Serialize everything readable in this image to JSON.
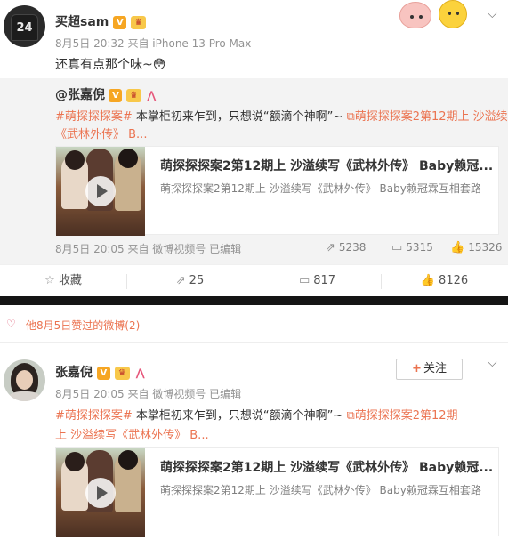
{
  "post1": {
    "username": "买超sam",
    "avatar_text": "24",
    "meta": "8月5日 20:32 来自 iPhone 13 Pro Max",
    "text": "还真有点那个味~",
    "text_emoji": "😳",
    "repost": {
      "author": "@张嘉倪",
      "topic": "#萌探探探案#",
      "body": " 本掌柜初来乍到，只想说“额滴个神啊”~ ",
      "link_label": "萌探探探案2第12期上 沙溢续写",
      "body_line2": "《武林外传》 B...",
      "video_title": "萌探探探案2第12期上 沙溢续写《武林外传》 Baby赖冠...",
      "video_subtitle": "萌探探探案2第12期上 沙溢续写《武林外传》 Baby赖冠霖互相套路",
      "meta": "8月5日 20:05 来自 微博视频号 已编辑",
      "stats": {
        "reposts": "5238",
        "comments": "5315",
        "likes": "15326"
      }
    },
    "actions": {
      "favorite": "收藏",
      "repost": "25",
      "comment": "817",
      "like": "8126"
    }
  },
  "likes_bar": {
    "text": "他8月5日赞过的微博(2)"
  },
  "post2": {
    "username": "张嘉倪",
    "follow_label": "关注",
    "meta": "8月5日 20:05 来自 微博视频号 已编辑",
    "topic": "#萌探探探案#",
    "body": " 本掌柜初来乍到，只想说“额滴个神啊”~ ",
    "link_label": "萌探探探案2第12期",
    "body_line2a": "上 沙溢续写《武林外传》 B...",
    "video_title": "萌探探探案2第12期上 沙溢续写《武林外传》 Baby赖冠...",
    "video_subtitle": "萌探探探案2第12期上 沙溢续写《武林外传》 Baby赖冠霖互相套路"
  },
  "colors": {
    "accent": "#eb7350",
    "meta": "#939393",
    "repost_bg": "#f3f3f3"
  },
  "icons": [
    "chevron-down-icon",
    "star-icon",
    "repost-icon",
    "comment-icon",
    "thumb-up-icon",
    "heart-icon",
    "link-video-icon",
    "plus-icon",
    "play-icon",
    "vip-badge-icon",
    "crown-badge-icon"
  ]
}
